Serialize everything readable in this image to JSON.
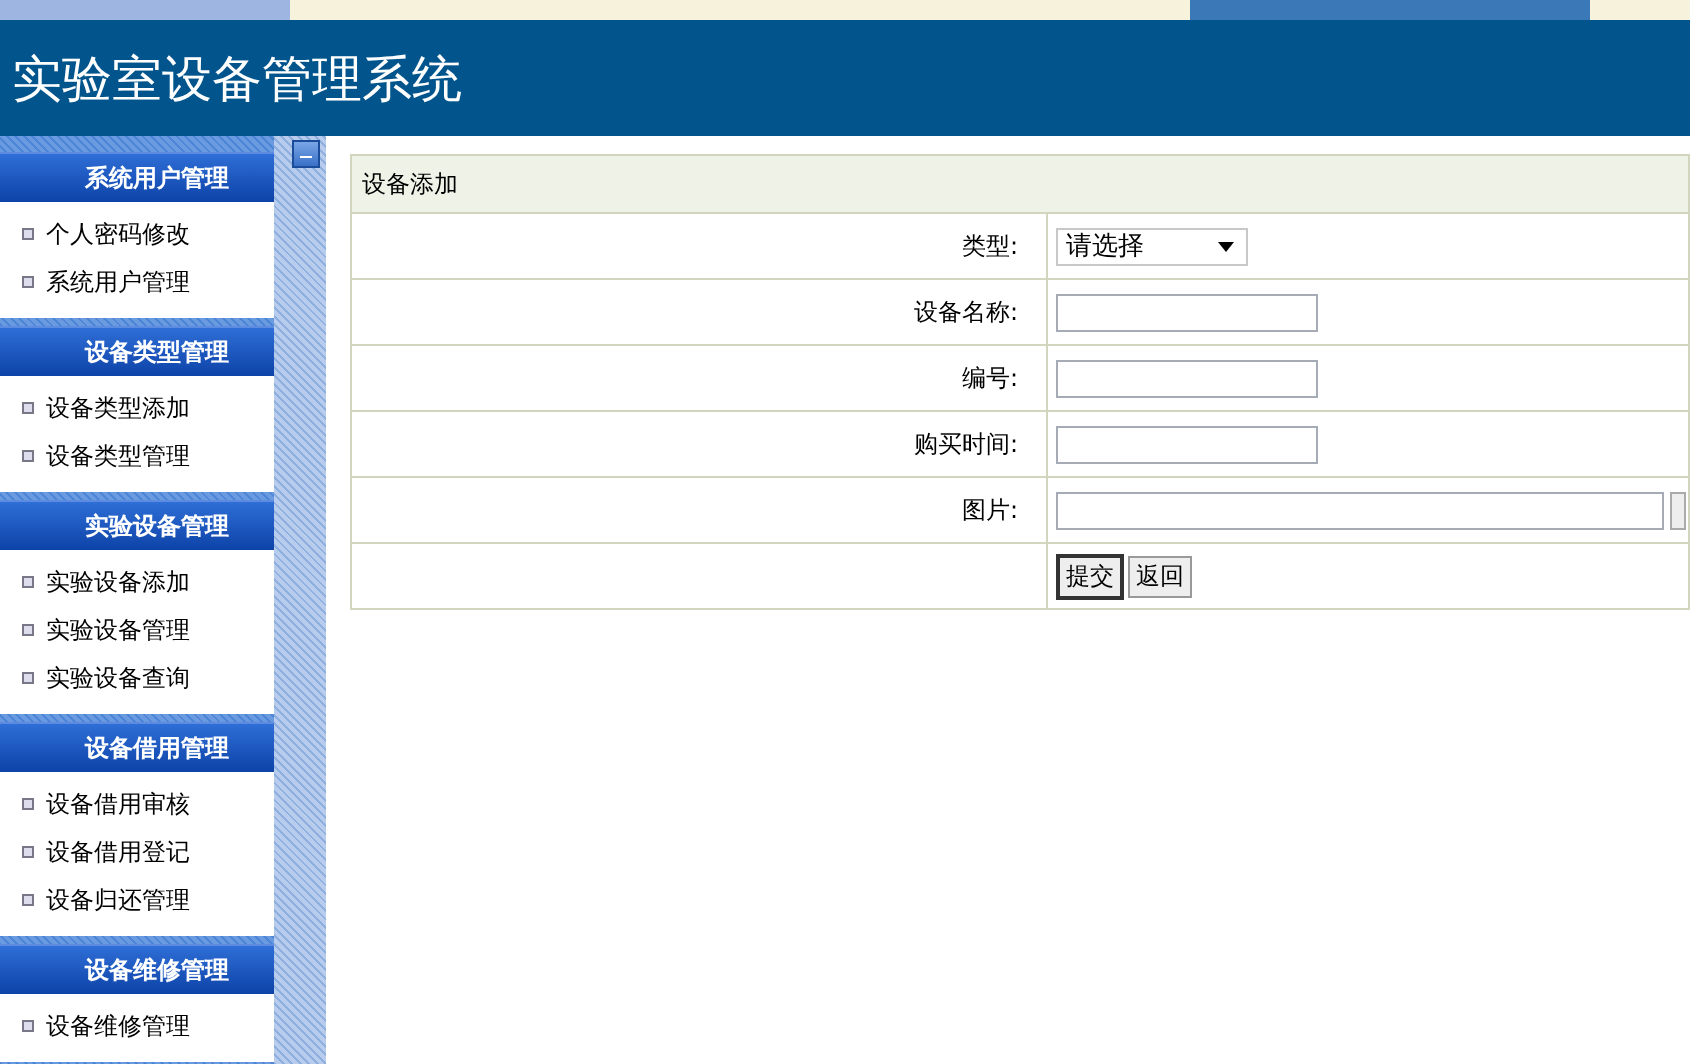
{
  "header": {
    "title": "实验室设备管理系统"
  },
  "sidebar": {
    "sections": [
      {
        "title": "系统用户管理",
        "items": [
          "个人密码修改",
          "系统用户管理"
        ]
      },
      {
        "title": "设备类型管理",
        "items": [
          "设备类型添加",
          "设备类型管理"
        ]
      },
      {
        "title": "实验设备管理",
        "items": [
          "实验设备添加",
          "实验设备管理",
          "实验设备查询"
        ]
      },
      {
        "title": "设备借用管理",
        "items": [
          "设备借用审核",
          "设备借用登记",
          "设备归还管理"
        ]
      },
      {
        "title": "设备维修管理",
        "items": [
          "设备维修管理"
        ]
      }
    ]
  },
  "form": {
    "title": "设备添加",
    "rows": [
      {
        "kind": "select",
        "label": "类型:",
        "value": "请选择"
      },
      {
        "kind": "text",
        "label": "设备名称:"
      },
      {
        "kind": "text",
        "label": "编号:"
      },
      {
        "kind": "text",
        "label": "购买时间:"
      },
      {
        "kind": "file",
        "label": "图片:"
      }
    ],
    "buttons": [
      "提交",
      "返回"
    ]
  }
}
